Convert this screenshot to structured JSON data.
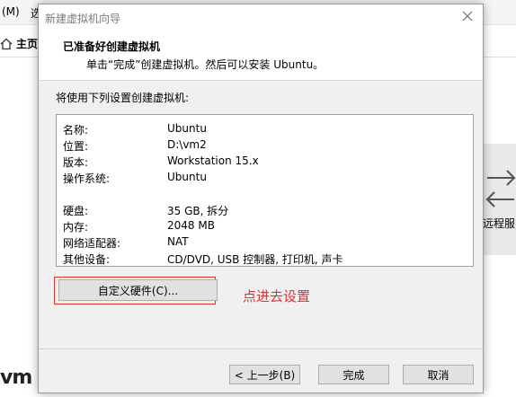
{
  "background": {
    "menu": [
      "(M)",
      "选"
    ],
    "home_tab": "主页",
    "remote_label": "远程服",
    "logo": "vm"
  },
  "dialog": {
    "title": "新建虚拟机向导",
    "header_title": "已准备好创建虚拟机",
    "header_subtitle": "单击“完成”创建虚拟机。然后可以安装 Ubuntu。",
    "intro": "将使用下列设置创建虚拟机:",
    "summary": [
      {
        "label": "名称:",
        "value": "Ubuntu"
      },
      {
        "label": "位置:",
        "value": "D:\\vm2"
      },
      {
        "label": "版本:",
        "value": "Workstation 15.x"
      },
      {
        "label": "操作系统:",
        "value": "Ubuntu"
      },
      {
        "label": "硬盘:",
        "value": "35 GB, 拆分"
      },
      {
        "label": "内存:",
        "value": "2048 MB"
      },
      {
        "label": "网络适配器:",
        "value": "NAT"
      },
      {
        "label": "其他设备:",
        "value": "CD/DVD, USB 控制器, 打印机, 声卡"
      }
    ],
    "customize_button": "自定义硬件(C)...",
    "annotation": "点进去设置",
    "back_button": "< 上一步(B)",
    "finish_button": "完成",
    "cancel_button": "取消"
  },
  "colors": {
    "annotation": "#e03030",
    "dialog_bg": "#f0f0f0"
  }
}
